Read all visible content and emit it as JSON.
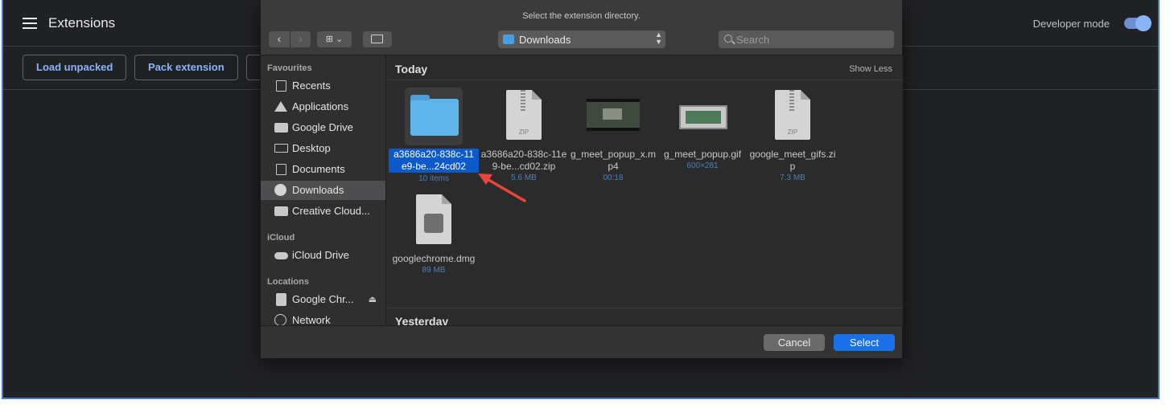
{
  "chrome": {
    "title": "Extensions",
    "developer_mode_label": "Developer mode",
    "developer_mode_on": true,
    "buttons": {
      "load_unpacked": "Load unpacked",
      "pack_extension": "Pack extension"
    }
  },
  "dialog": {
    "title": "Select the extension directory.",
    "view_icon": "⊞ ⌄",
    "location": "Downloads",
    "search_placeholder": "Search",
    "sidebar": {
      "favourites_label": "Favourites",
      "favourites": [
        {
          "label": "Recents",
          "icon": "recents-icon"
        },
        {
          "label": "Applications",
          "icon": "applications-icon"
        },
        {
          "label": "Google Drive",
          "icon": "folder-icon"
        },
        {
          "label": "Desktop",
          "icon": "desktop-icon"
        },
        {
          "label": "Documents",
          "icon": "documents-icon"
        },
        {
          "label": "Downloads",
          "icon": "downloads-icon",
          "selected": true
        },
        {
          "label": "Creative Cloud...",
          "icon": "folder-icon"
        }
      ],
      "icloud_label": "iCloud",
      "icloud": [
        {
          "label": "iCloud Drive",
          "icon": "cloud-icon"
        }
      ],
      "locations_label": "Locations",
      "locations": [
        {
          "label": "Google Chr...",
          "icon": "drive-icon"
        },
        {
          "label": "Network",
          "icon": "network-icon"
        }
      ]
    },
    "sections": {
      "today": "Today",
      "show_less": "Show Less",
      "yesterday": "Yesterday"
    },
    "files": [
      {
        "name": "a3686a20-838c-11e9-be...24cd02",
        "meta": "10 items",
        "kind": "folder",
        "selected": true
      },
      {
        "name": "a3686a20-838c-11e9-be...cd02.zip",
        "meta": "5.6 MB",
        "kind": "zip",
        "badge": "ZIP"
      },
      {
        "name": "g_meet_popup_x.mp4",
        "meta": "00:18",
        "kind": "video"
      },
      {
        "name": "g_meet_popup.gif",
        "meta": "600×281",
        "kind": "gif"
      },
      {
        "name": "google_meet_gifs.zip",
        "meta": "7.3 MB",
        "kind": "zip",
        "badge": "ZIP"
      },
      {
        "name": "googlechrome.dmg",
        "meta": "89 MB",
        "kind": "dmg"
      }
    ],
    "buttons": {
      "cancel": "Cancel",
      "select": "Select"
    }
  },
  "colors": {
    "chrome_bg": "#202124",
    "accent_blue": "#8ab4f8",
    "selection_blue": "#0c5ac9",
    "select_button": "#1a70e8",
    "annotation_arrow": "#e8453c"
  }
}
